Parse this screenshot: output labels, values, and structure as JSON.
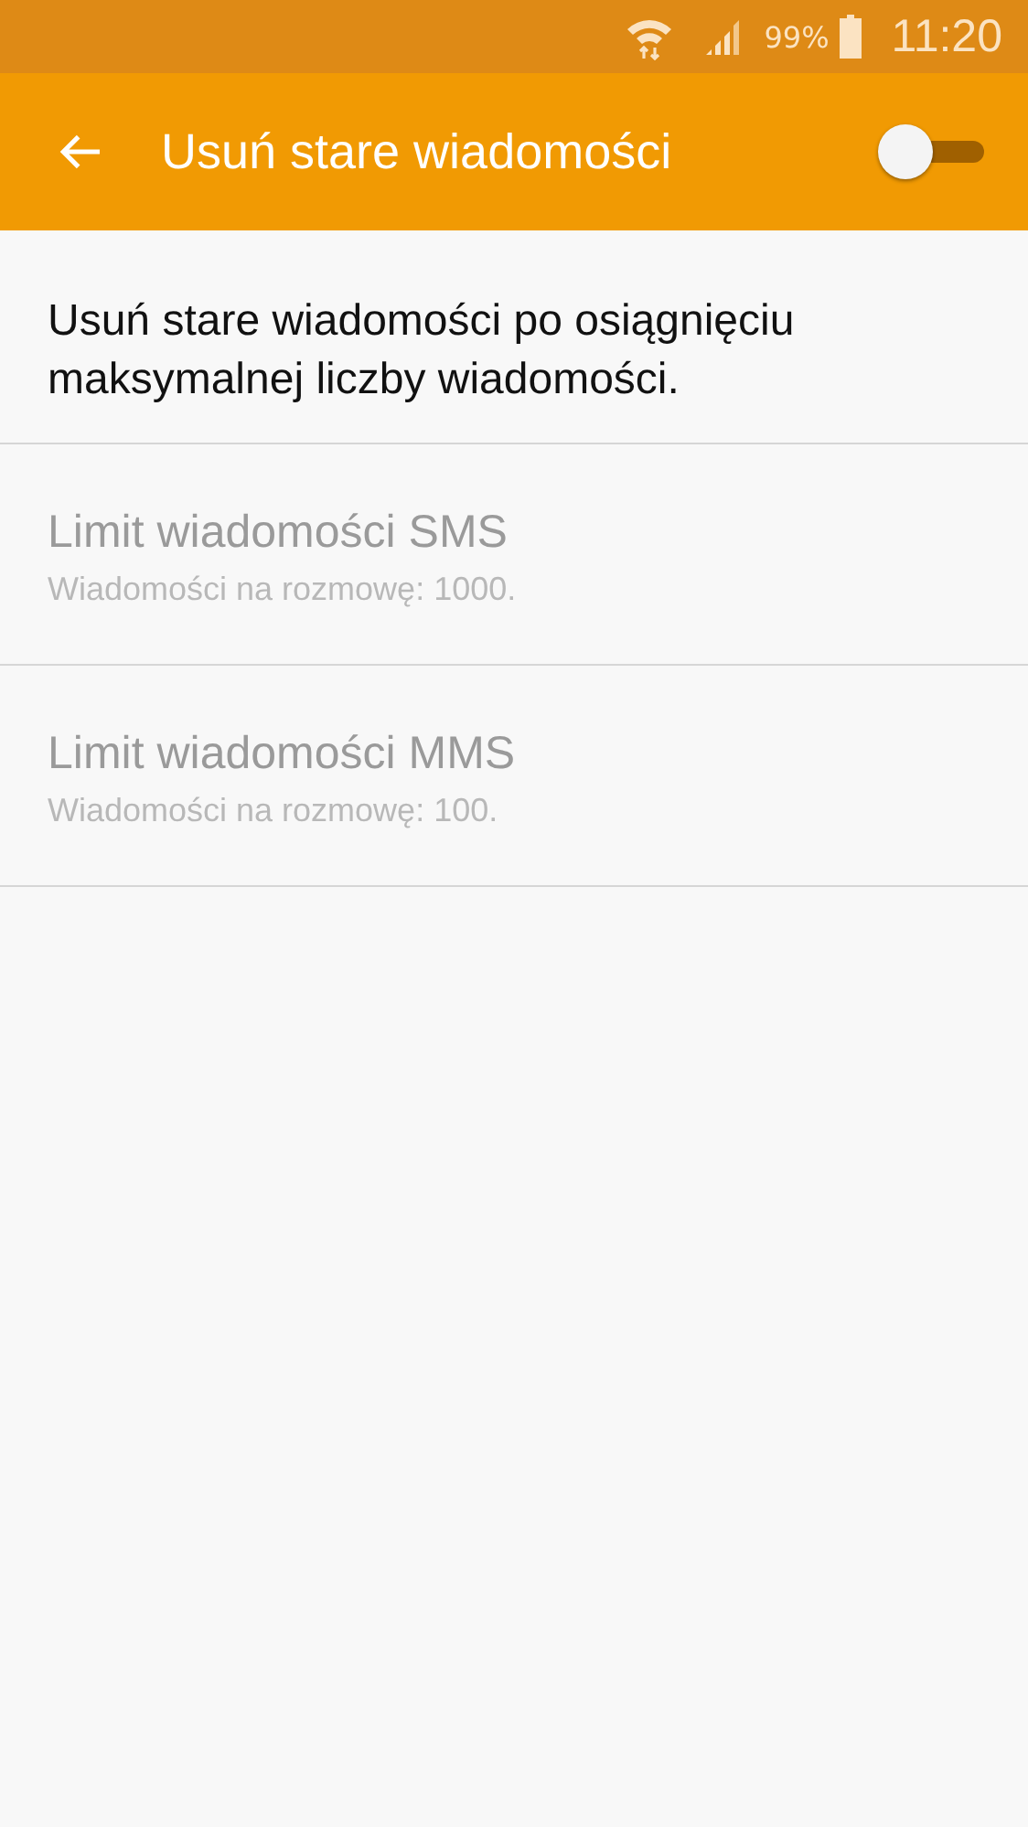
{
  "status_bar": {
    "battery": "99%",
    "time": "11:20"
  },
  "app_bar": {
    "title": "Usuń stare wiadomości",
    "toggle": {
      "on": false
    }
  },
  "description": "Usuń stare wiadomości po osiągnięciu maksymalnej liczby wiadomości.",
  "items": [
    {
      "title": "Limit wiadomości SMS",
      "summary": "Wiadomości na rozmowę: 1000.",
      "disabled": true
    },
    {
      "title": "Limit wiadomości MMS",
      "summary": "Wiadomości na rozmowę: 100.",
      "disabled": true
    }
  ]
}
